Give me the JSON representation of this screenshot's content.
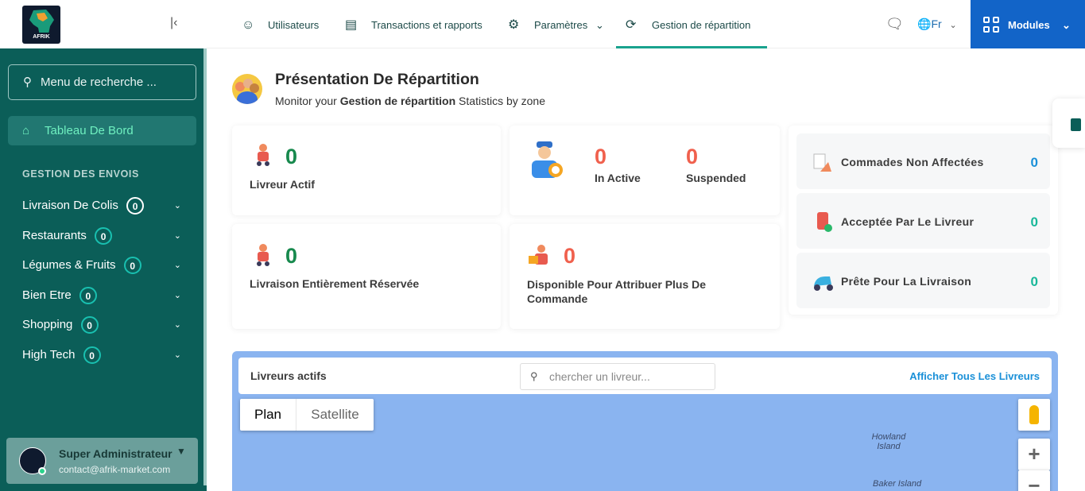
{
  "sidebar": {
    "logo_text": "AFRIK MARKET",
    "search_placeholder": "Menu de recherche ...",
    "dashboard_label": "Tableau De Bord",
    "section_title": "GESTION DES ENVOIS",
    "items": [
      {
        "label": "Livraison De Colis",
        "count": "0",
        "badge_color": "#ffffff"
      },
      {
        "label": "Restaurants",
        "count": "0",
        "badge_color": "#19c0b0"
      },
      {
        "label": "Légumes & Fruits",
        "count": "0",
        "badge_color": "#19c0b0"
      },
      {
        "label": "Bien Etre",
        "count": "0",
        "badge_color": "#19c0b0"
      },
      {
        "label": "Shopping",
        "count": "0",
        "badge_color": "#19c0b0"
      },
      {
        "label": "High Tech",
        "count": "0",
        "badge_color": "#19c0b0"
      }
    ],
    "profile": {
      "name": "Super Administrateur",
      "email": "contact@afrik-market.com"
    }
  },
  "topbar": {
    "tabs": [
      {
        "label": "Utilisateurs",
        "icon": "user-icon"
      },
      {
        "label": "Transactions et rapports",
        "icon": "clipboard-icon"
      },
      {
        "label": "Paramètres",
        "icon": "gear-icon"
      },
      {
        "label": "Gestion de répartition",
        "icon": "refresh-icon",
        "active": true
      }
    ],
    "language": "Fr",
    "modules_label": "Modules"
  },
  "header": {
    "title": "Présentation De Répartition",
    "subtitle_pre": "Monitor your ",
    "subtitle_bold": "Gestion de répartition",
    "subtitle_post": " Statistics by zone"
  },
  "stats": {
    "livreur_actif": {
      "value": "0",
      "label": "Livreur Actif"
    },
    "in_active": {
      "value": "0",
      "label": "In Active"
    },
    "suspended": {
      "value": "0",
      "label": "Suspended"
    },
    "entierement_reservee": {
      "value": "0",
      "label": "Livraison Entièrement Réservée"
    },
    "disponible": {
      "value": "0",
      "label": "Disponible Pour Attribuer Plus De Commande"
    }
  },
  "orders": [
    {
      "label": "Commades Non Affectées",
      "value": "0",
      "color": "#1a90d8"
    },
    {
      "label": "Acceptée Par Le Livreur",
      "value": "0",
      "color": "#19b89a"
    },
    {
      "label": "Prête Pour La Livraison",
      "value": "0",
      "color": "#19b89a"
    }
  ],
  "map": {
    "title": "Livreurs actifs",
    "search_placeholder": "chercher un livreur...",
    "show_all_link": "Afficher Tous Les Livreurs",
    "type_plan": "Plan",
    "type_satellite": "Satellite",
    "zoom_in": "+",
    "zoom_out": "−",
    "places": [
      "Howland Island",
      "Baker Island"
    ]
  },
  "colors": {
    "sidebar": "#0b5e58",
    "accent": "#19a28e",
    "modules": "#1264c8",
    "map_water": "#8ab4f0"
  }
}
